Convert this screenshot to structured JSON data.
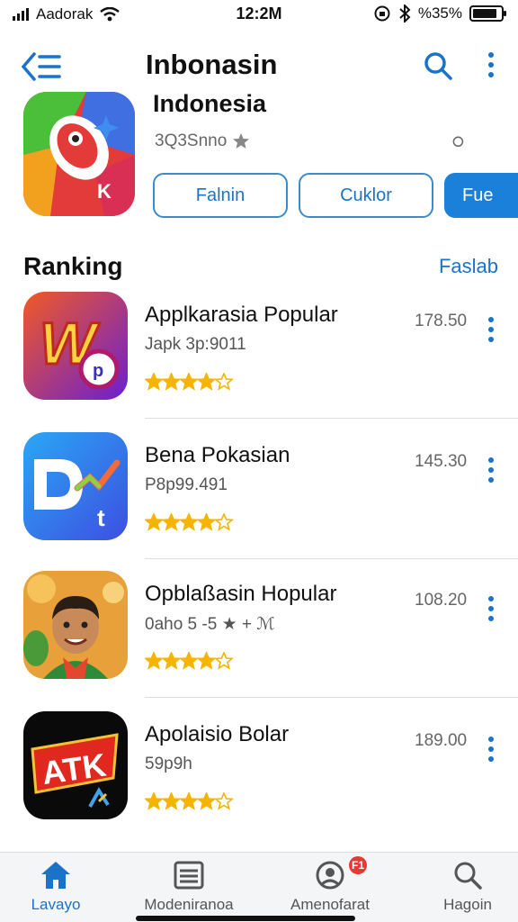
{
  "status": {
    "carrier": "Aadorak",
    "time": "12:2M",
    "battery": "%35%"
  },
  "header": {
    "title": "Inbonasin",
    "back_icon": "back-list-icon",
    "search_icon": "search-icon",
    "more_icon": "more-vertical-icon"
  },
  "hero": {
    "subtitle": "Indonesia",
    "meta": "3Q3Snno",
    "tiny": "⭘",
    "buttons": [
      "Falnin",
      "Cuklor",
      "Fue"
    ]
  },
  "ranking": {
    "title": "Ranking",
    "link": "Faslab"
  },
  "apps": [
    {
      "name": "Applkarasia Popular",
      "sub": "Japk 3p:9011",
      "size": "178.50",
      "rating": 4.5
    },
    {
      "name": "Bena Pokasian",
      "sub": "P8p99.491",
      "size": "145.30",
      "rating": 4.5
    },
    {
      "name": "Opblaßasin Hopular",
      "sub": "0aho 5 -5 ★ + ℳ",
      "size": "108.20",
      "rating": 4.5
    },
    {
      "name": "Apolaisio Bolar",
      "sub": "59p9h",
      "size": "189.00",
      "rating": 4.5
    }
  ],
  "tabs": [
    {
      "label": "Lavayo",
      "icon": "home-icon",
      "active": true
    },
    {
      "label": "Modeniranoa",
      "icon": "list-icon",
      "active": false
    },
    {
      "label": "Amenofarat",
      "icon": "account-icon",
      "active": false,
      "badge": "F1"
    },
    {
      "label": "Hagoin",
      "icon": "search-icon",
      "active": false
    }
  ],
  "colors": {
    "accent": "#1a73c8",
    "star": "#f5b400"
  }
}
